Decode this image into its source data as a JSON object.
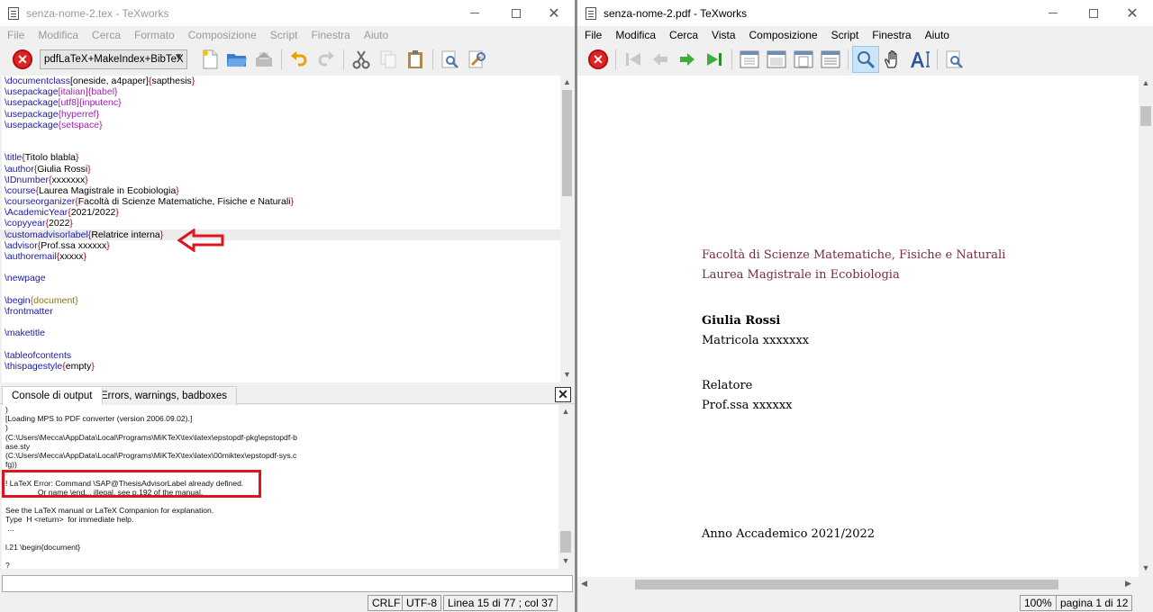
{
  "left_window": {
    "title": "senza-nome-2.tex - TeXworks",
    "menu": [
      "File",
      "Modifica",
      "Cerca",
      "Formato",
      "Composizione",
      "Script",
      "Finestra",
      "Aiuto"
    ],
    "engine_select": "pdfLaTeX+MakeIndex+BibTeX",
    "editor_lines": [
      [
        [
          "cmd",
          "\\documentclass"
        ],
        [
          "txt",
          "[oneside, a4paper]"
        ],
        [
          "brk",
          "{"
        ],
        [
          "txt",
          "sapthesis"
        ],
        [
          "brk",
          "}"
        ]
      ],
      [
        [
          "cmd",
          "\\usepackage"
        ],
        [
          "pkg",
          "[italian]"
        ],
        [
          "pkg",
          "{babel}"
        ]
      ],
      [
        [
          "cmd",
          "\\usepackage"
        ],
        [
          "pkg",
          "[utf8]"
        ],
        [
          "pkg",
          "{inputenc}"
        ]
      ],
      [
        [
          "cmd",
          "\\usepackage"
        ],
        [
          "pkg",
          "{hyperref}"
        ]
      ],
      [
        [
          "cmd",
          "\\usepackage"
        ],
        [
          "pkg",
          "{setspace}"
        ]
      ],
      [],
      [],
      [
        [
          "cmd",
          "\\title"
        ],
        [
          "brk",
          "{"
        ],
        [
          "txt",
          "Titolo blabla"
        ],
        [
          "brk",
          "}"
        ]
      ],
      [
        [
          "cmd",
          "\\author"
        ],
        [
          "brk",
          "{"
        ],
        [
          "txt",
          "Giulia Rossi"
        ],
        [
          "brk",
          "}"
        ]
      ],
      [
        [
          "cmd",
          "\\IDnumber"
        ],
        [
          "brk",
          "{"
        ],
        [
          "txt",
          "xxxxxxx"
        ],
        [
          "brk",
          "}"
        ]
      ],
      [
        [
          "cmd",
          "\\course"
        ],
        [
          "brk",
          "{"
        ],
        [
          "txt",
          "Laurea Magistrale in Ecobiologia"
        ],
        [
          "brk",
          "}"
        ]
      ],
      [
        [
          "cmd",
          "\\courseorganizer"
        ],
        [
          "brk",
          "{"
        ],
        [
          "txt",
          "Facoltà di Scienze Matematiche, Fisiche e Naturali"
        ],
        [
          "brk",
          "}"
        ]
      ],
      [
        [
          "cmd",
          "\\AcademicYear"
        ],
        [
          "brk",
          "{"
        ],
        [
          "txt",
          "2021/2022"
        ],
        [
          "brk",
          "}"
        ]
      ],
      [
        [
          "cmd",
          "\\copyyear"
        ],
        [
          "brk",
          "{"
        ],
        [
          "txt",
          "2022"
        ],
        [
          "brk",
          "}"
        ]
      ],
      [
        [
          "cmd",
          "\\customadvisorlabel"
        ],
        [
          "brk",
          "{"
        ],
        [
          "txt",
          "Relatrice interna"
        ],
        [
          "brk",
          "}"
        ]
      ],
      [
        [
          "cmd",
          "\\advisor"
        ],
        [
          "brk",
          "{"
        ],
        [
          "txt",
          "Prof.ssa xxxxxx"
        ],
        [
          "brk",
          "}"
        ]
      ],
      [
        [
          "cmd",
          "\\authoremail"
        ],
        [
          "brk",
          "{"
        ],
        [
          "txt",
          "xxxxx"
        ],
        [
          "brk",
          "}"
        ]
      ],
      [],
      [
        [
          "cmd",
          "\\newpage"
        ]
      ],
      [],
      [
        [
          "cmd",
          "\\begin"
        ],
        [
          "env",
          "{document}"
        ]
      ],
      [
        [
          "cmd",
          "\\frontmatter"
        ]
      ],
      [],
      [
        [
          "cmd",
          "\\maketitle"
        ]
      ],
      [],
      [
        [
          "cmd",
          "\\tableofcontents"
        ]
      ],
      [
        [
          "cmd",
          "\\thispagestyle"
        ],
        [
          "brk",
          "{"
        ],
        [
          "txt",
          "empty"
        ],
        [
          "brk",
          "}"
        ]
      ]
    ],
    "current_line_index": 14,
    "tabs": [
      "Console di output",
      "Errors, warnings, badboxes"
    ],
    "console_lines": [
      ")",
      "[Loading MPS to PDF converter (version 2006.09.02).]",
      ")",
      "(C:\\Users\\Mecca\\AppData\\Local\\Programs\\MiKTeX\\tex\\latex\\epstopdf-pkg\\epstopdf-b",
      "ase.sty",
      "(C:\\Users\\Mecca\\AppData\\Local\\Programs\\MiKTeX\\tex\\latex\\00miktex\\epstopdf-sys.c",
      "fg))",
      "",
      "! LaTeX Error: Command \\SAP@ThesisAdvisorLabel already defined.",
      "               Or name \\end... illegal, see p.192 of the manual.",
      "",
      "See the LaTeX manual or LaTeX Companion for explanation.",
      "Type  H <return>  for immediate help.",
      " ...",
      "",
      "l.21 \\begin{document}",
      "",
      "?"
    ],
    "status": {
      "line_ending": "CRLF",
      "encoding": "UTF-8",
      "position": "Linea 15 di 77 ; col 37"
    }
  },
  "right_window": {
    "title": "senza-nome-2.pdf - TeXworks",
    "menu": [
      "File",
      "Modifica",
      "Cerca",
      "Vista",
      "Composizione",
      "Script",
      "Finestra",
      "Aiuto"
    ],
    "pdf": {
      "faculty": "Facoltà di Scienze Matematiche, Fisiche e Naturali",
      "course": "Laurea Magistrale in Ecobiologia",
      "author": "Giulia Rossi",
      "matricola": "Matricola xxxxxxx",
      "advisor_label": "Relatore",
      "advisor": "Prof.ssa xxxxxx",
      "academic_year": "Anno Accademico 2021/2022"
    },
    "status": {
      "zoom": "100%",
      "page": "pagina 1 di 12"
    }
  },
  "colors": {
    "command": "#1a1aa6",
    "package": "#a020b0",
    "bracket": "#b0102a",
    "environment": "#8a7a00",
    "pdf_heading": "#7a2a3a",
    "annotation": "#e0141e"
  }
}
